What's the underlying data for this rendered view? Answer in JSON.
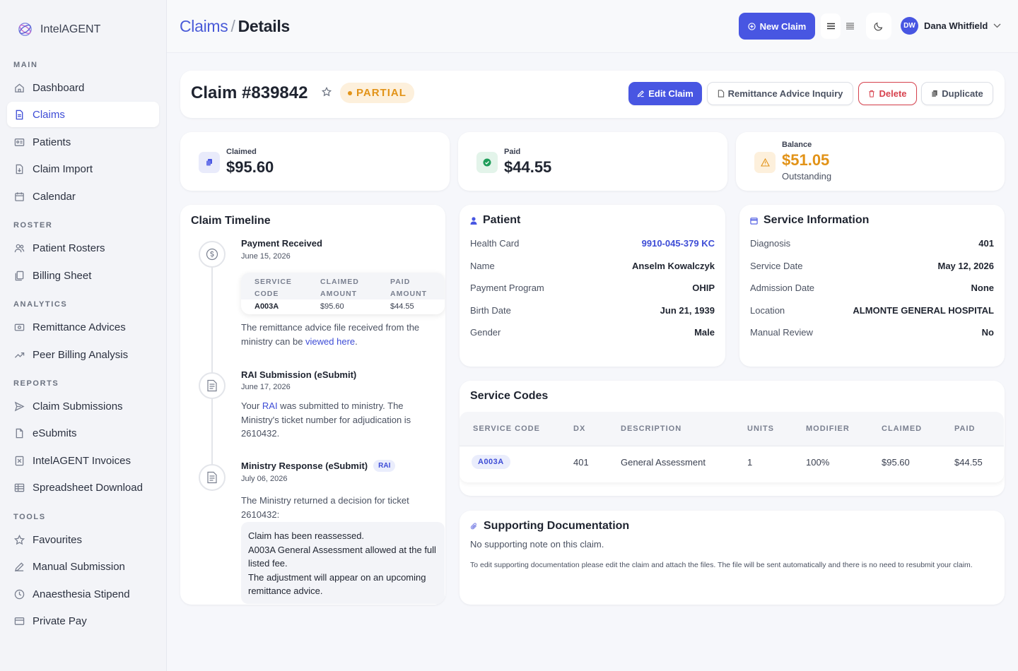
{
  "app": {
    "name": "IntelAGENT"
  },
  "sidebar": {
    "sections": [
      {
        "title": "MAIN",
        "items": [
          {
            "label": "Dashboard",
            "icon": "home-icon"
          },
          {
            "label": "Claims",
            "icon": "document-icon",
            "active": true
          },
          {
            "label": "Patients",
            "icon": "id-card-icon"
          },
          {
            "label": "Claim Import",
            "icon": "file-import-icon"
          },
          {
            "label": "Calendar",
            "icon": "calendar-icon"
          }
        ]
      },
      {
        "title": "ROSTER",
        "items": [
          {
            "label": "Patient Rosters",
            "icon": "users-icon"
          },
          {
            "label": "Billing Sheet",
            "icon": "copy-icon"
          }
        ]
      },
      {
        "title": "ANALYTICS",
        "items": [
          {
            "label": "Remittance Advices",
            "icon": "money-icon"
          },
          {
            "label": "Peer Billing Analysis",
            "icon": "trend-icon"
          }
        ]
      },
      {
        "title": "REPORTS",
        "items": [
          {
            "label": "Claim Submissions",
            "icon": "send-icon"
          },
          {
            "label": "eSubmits",
            "icon": "file-icon"
          },
          {
            "label": "IntelAGENT Invoices",
            "icon": "invoice-icon"
          },
          {
            "label": "Spreadsheet Download",
            "icon": "spreadsheet-icon"
          }
        ]
      },
      {
        "title": "TOOLS",
        "items": [
          {
            "label": "Favourites",
            "icon": "star-icon"
          },
          {
            "label": "Manual Submission",
            "icon": "pencil-icon"
          },
          {
            "label": "Anaesthesia Stipend",
            "icon": "clock-icon"
          },
          {
            "label": "Private Pay",
            "icon": "credit-card-icon"
          }
        ]
      }
    ]
  },
  "header": {
    "breadcrumb_parent": "Claims",
    "breadcrumb_sep": "/",
    "breadcrumb_current": "Details",
    "new_claim_label": "New Claim",
    "user_initials": "DW",
    "user_name": "Dana Whitfield"
  },
  "claim": {
    "title": "Claim #839842",
    "status": "PARTIAL",
    "actions": {
      "edit": "Edit Claim",
      "remittance": "Remittance Advice Inquiry",
      "delete": "Delete",
      "duplicate": "Duplicate"
    }
  },
  "stats": {
    "claimed": {
      "label": "Claimed",
      "value": "$95.60"
    },
    "paid": {
      "label": "Paid",
      "value": "$44.55"
    },
    "balance": {
      "label": "Balance",
      "value": "$51.05",
      "sub": "Outstanding"
    }
  },
  "timeline": {
    "title": "Claim Timeline",
    "events": [
      {
        "title": "Payment Received",
        "date": "June 15, 2026",
        "table": {
          "headers": [
            [
              "SERVICE",
              "CODE"
            ],
            [
              "CLAIMED",
              "AMOUNT"
            ],
            [
              "PAID",
              "AMOUNT"
            ]
          ],
          "row": [
            "A003A",
            "$95.60",
            "$44.55"
          ]
        },
        "text": "The remittance advice file received from the ministry can be ",
        "link": "viewed here",
        "text_end": "."
      },
      {
        "title": "RAI Submission (eSubmit)",
        "date": "June 17, 2026",
        "text_pre": "Your ",
        "link": "RAI",
        "text_post": " was submitted to ministry. The Ministry's ticket number for adjudication is 2610432."
      },
      {
        "title": "Ministry Response (eSubmit)",
        "badge": "RAI",
        "date": "July 06, 2026",
        "text": "The Ministry returned a decision for ticket 2610432:",
        "quote": [
          "Claim has been reassessed.",
          "A003A General Assessment allowed at the full listed fee.",
          "The adjustment will appear on an upcoming remittance advice."
        ]
      }
    ]
  },
  "patient": {
    "title": "Patient",
    "fields": [
      {
        "key": "Health Card",
        "value": "9910-045-379 KC"
      },
      {
        "key": "Name",
        "value": "Anselm Kowalczyk"
      },
      {
        "key": "Payment Program",
        "value": "OHIP"
      },
      {
        "key": "Birth Date",
        "value": "Jun 21, 1939"
      },
      {
        "key": "Gender",
        "value": "Male"
      }
    ]
  },
  "service_info": {
    "title": "Service Information",
    "fields": [
      {
        "key": "Diagnosis",
        "value": "401"
      },
      {
        "key": "Service Date",
        "value": "May 12, 2026"
      },
      {
        "key": "Admission Date",
        "value": "None"
      },
      {
        "key": "Location",
        "value": "ALMONTE GENERAL HOSPITAL"
      },
      {
        "key": "Manual Review",
        "value": "No"
      }
    ]
  },
  "service_codes": {
    "title": "Service Codes",
    "headers": [
      "SERVICE CODE",
      "DX",
      "DESCRIPTION",
      "UNITS",
      "MODIFIER",
      "CLAIMED",
      "PAID"
    ],
    "rows": [
      [
        "A003A",
        "401",
        "General Assessment",
        "1",
        "100%",
        "$95.60",
        "$44.55"
      ]
    ]
  },
  "documentation": {
    "title": "Supporting Documentation",
    "note": "No supporting note on this claim.",
    "help": "To edit supporting documentation please edit the claim and attach the files. The file will be sent automatically and there is no need to resubmit your claim."
  },
  "colors": {
    "accent": "#4856e2",
    "partial": "#e29318",
    "paid": "#1f9d5a",
    "delete": "#d7424e"
  }
}
